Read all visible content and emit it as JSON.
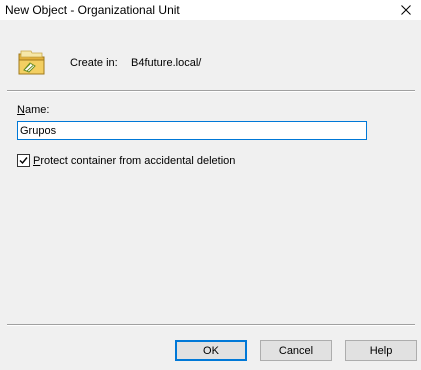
{
  "window": {
    "title": "New Object - Organizational Unit",
    "close_icon": "close-icon"
  },
  "header": {
    "icon": "organizational-unit-icon",
    "create_in_label": "Create in:",
    "create_in_path": "B4future.local/"
  },
  "form": {
    "name_label_first": "N",
    "name_label_rest": "ame:",
    "name_value": "Grupos",
    "protect_checked": true,
    "protect_label_first": "P",
    "protect_label_rest": "rotect container from accidental deletion"
  },
  "buttons": {
    "ok": "OK",
    "cancel": "Cancel",
    "help": "Help"
  },
  "colors": {
    "focus_accent": "#0078d7",
    "background": "#f0f0f0"
  }
}
